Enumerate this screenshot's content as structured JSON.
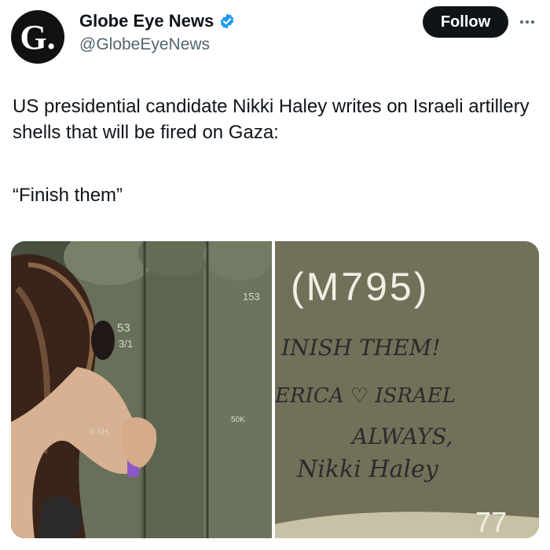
{
  "tweet": {
    "avatar_letter": "G.",
    "author_name": "Globe Eye News",
    "author_handle": "@GlobeEyeNews",
    "follow_label": "Follow",
    "text": "US presidential candidate Nikki Haley writes on Israeli artillery shells that will be fired on Gaza:",
    "quote": "“Finish them”"
  },
  "media": {
    "left_shell_marks": [
      "153",
      "53",
      "3/1"
    ],
    "right_photo": {
      "stencil": "(M795)",
      "line1": "INISH THEM!",
      "line2": "ERICA ♡ ISRAEL",
      "line3": "ALWAYS,",
      "signature": "Nikki Haley",
      "bottom_number": "77"
    }
  },
  "colors": {
    "verified": "#1d9bf0",
    "follow_bg": "#0f1419",
    "secondary_text": "#536471"
  }
}
